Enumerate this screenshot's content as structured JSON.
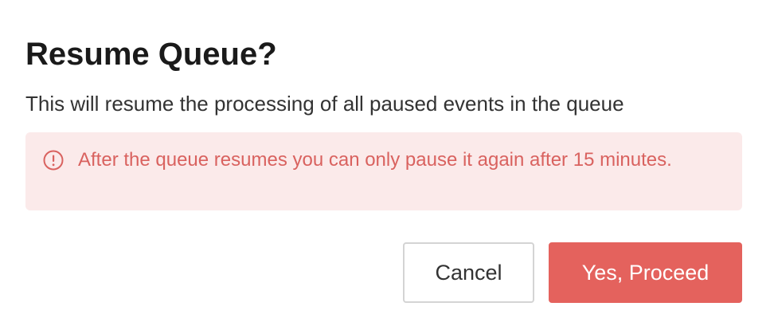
{
  "dialog": {
    "title": "Resume Queue?",
    "description": "This will resume the processing of all paused events in the queue"
  },
  "alert": {
    "icon": "exclamation-circle-icon",
    "message": "After the queue resumes you can only pause it again after 15 minutes.",
    "text_color": "#d9625f",
    "background_color": "#fbeaea"
  },
  "actions": {
    "cancel_label": "Cancel",
    "proceed_label": "Yes, Proceed",
    "proceed_color": "#e4625d"
  }
}
